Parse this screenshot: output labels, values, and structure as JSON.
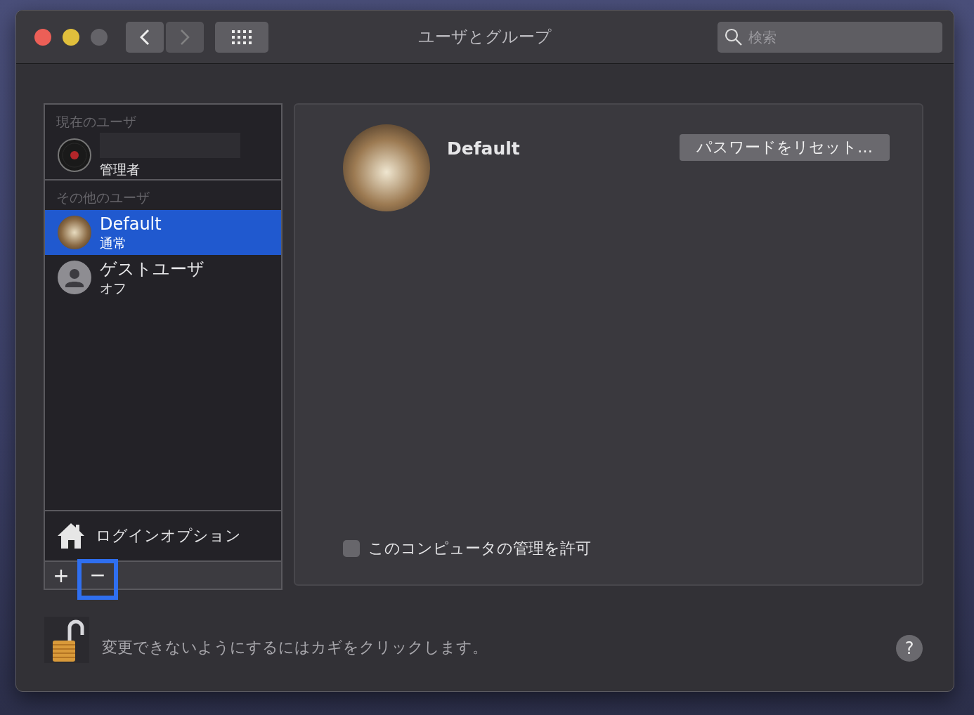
{
  "window": {
    "title": "ユーザとグループ"
  },
  "toolbar": {
    "search": {
      "placeholder": "検索"
    }
  },
  "sidebar": {
    "sections": [
      {
        "header": "現在のユーザ",
        "users": [
          {
            "kind": "record",
            "role": "管理者",
            "selected": false
          }
        ]
      },
      {
        "header": "その他のユーザ",
        "users": [
          {
            "kind": "photo",
            "name": "Default",
            "role": "通常",
            "selected": true
          },
          {
            "kind": "guest",
            "name": "ゲストユーザ",
            "role": "オフ",
            "selected": false
          }
        ]
      }
    ],
    "login_options": "ログインオプション",
    "buttons": [
      {
        "label": "+",
        "highlighted": false
      },
      {
        "label": "−",
        "highlighted": true
      }
    ]
  },
  "detail": {
    "user_name": "Default",
    "reset_button": "パスワードをリセット…",
    "admin_checkbox": {
      "label": "このコンピュータの管理を許可",
      "checked": false
    }
  },
  "footer": {
    "lock_text": "変更できないようにするにはカギをクリックします。",
    "help": "?"
  }
}
